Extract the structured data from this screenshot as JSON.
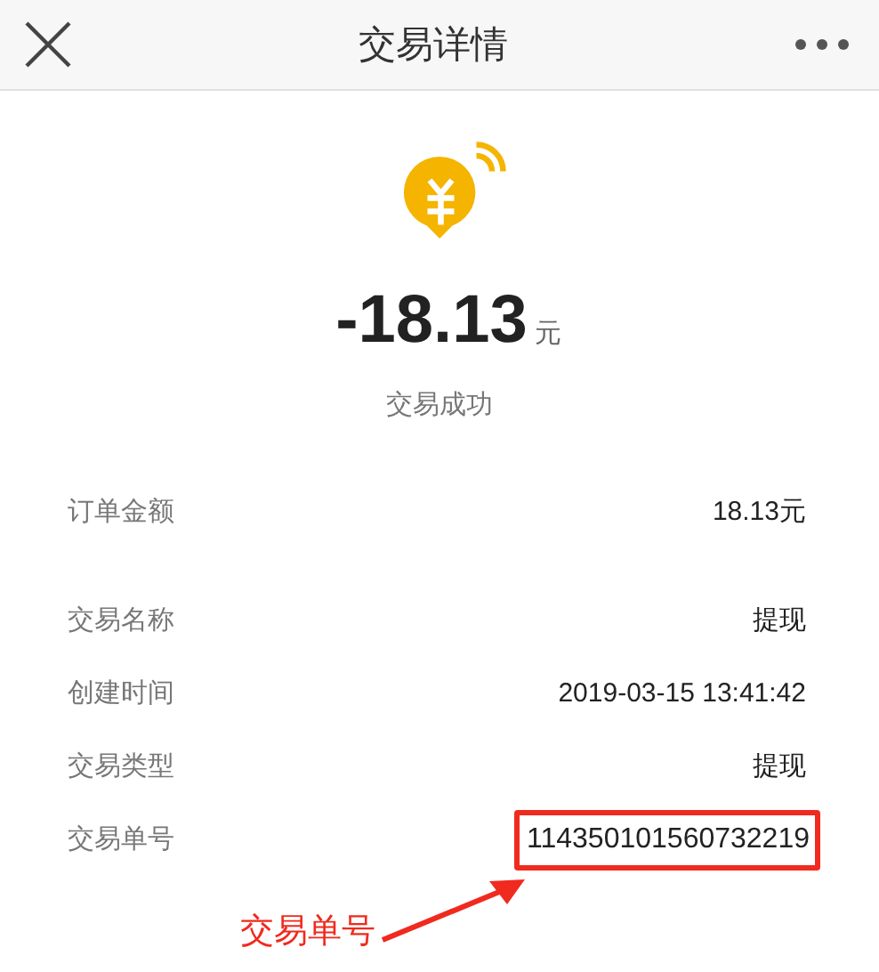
{
  "window": {
    "title": "交易详情"
  },
  "summary": {
    "amount": "-18.13",
    "unit": "元",
    "status": "交易成功"
  },
  "summary_rows": [
    {
      "label": "订单金额",
      "value": "18.13元",
      "highlighted": false
    }
  ],
  "detail_rows": [
    {
      "label": "交易名称",
      "value": "提现",
      "highlighted": false
    },
    {
      "label": "创建时间",
      "value": "2019-03-15 13:41:42",
      "highlighted": false
    },
    {
      "label": "交易类型",
      "value": "提现",
      "highlighted": false
    },
    {
      "label": "交易单号",
      "value": "114350101560732219",
      "highlighted": true
    }
  ],
  "annotation": {
    "text": "交易单号"
  }
}
